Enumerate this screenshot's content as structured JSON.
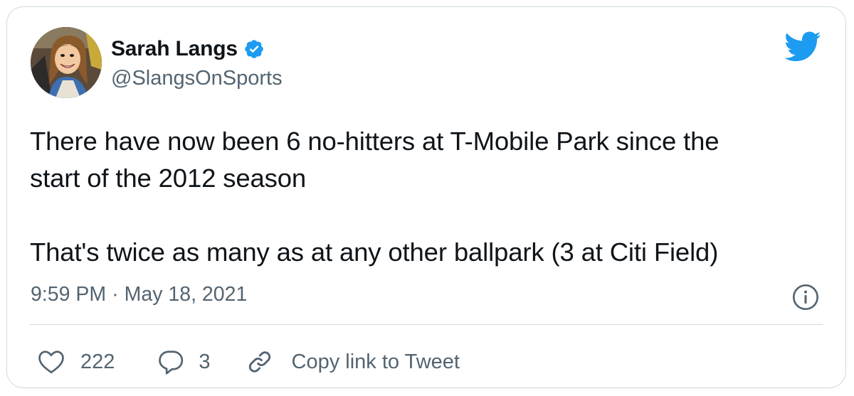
{
  "author": {
    "display_name": "Sarah Langs",
    "handle": "@SlangsOnSports",
    "verified": true,
    "avatar_icon": "profile-photo-cartoon"
  },
  "tweet": {
    "paragraphs": [
      [
        "There have now been 6 no-hitters at T-Mobile Park since the",
        "start of the 2012 season"
      ],
      [
        "That's twice as many as at any other ballpark (3 at Citi Field)"
      ]
    ],
    "time": "9:59 PM",
    "separator": "·",
    "date": "May 18, 2021"
  },
  "actions": {
    "likes": "222",
    "replies": "3",
    "copy_link_label": "Copy link to Tweet"
  },
  "icons": {
    "brand": "twitter-bird-icon",
    "verified": "verified-badge-icon",
    "info": "info-icon",
    "like": "heart-icon",
    "reply": "reply-bubble-icon",
    "copy": "link-icon"
  },
  "colors": {
    "brand_blue": "#1d9bf0",
    "text_primary": "#0f1419",
    "text_secondary": "#536471",
    "border": "#cfd9de"
  }
}
